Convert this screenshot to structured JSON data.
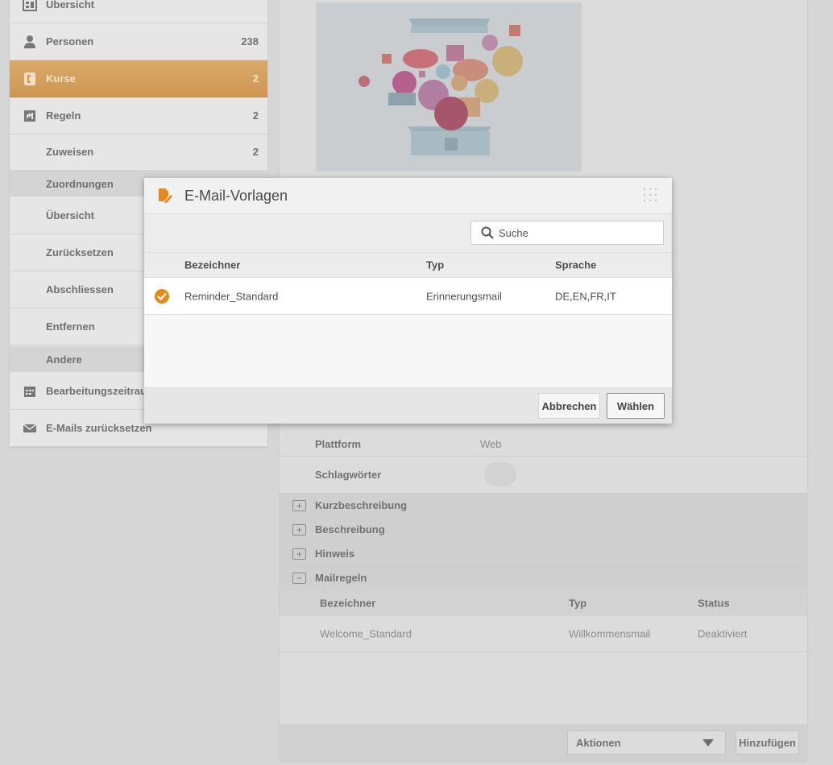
{
  "sidebar": {
    "items": [
      {
        "label": "Übersicht",
        "count": "",
        "icon": "dashboard-icon"
      },
      {
        "label": "Personen",
        "count": "238",
        "icon": "person-icon"
      },
      {
        "label": "Kurse",
        "count": "2",
        "icon": "course-icon"
      },
      {
        "label": "Regeln",
        "count": "2",
        "icon": "rule-icon"
      },
      {
        "label": "Zuweisen",
        "count": "2"
      }
    ],
    "section_zuordnungen": "Zuordnungen",
    "zuordnungen_items": [
      "Übersicht",
      "Zurücksetzen",
      "Abschliessen",
      "Entfernen"
    ],
    "section_andere": "Andere",
    "andere_items": [
      {
        "label": "Bearbeitungszeitraum",
        "icon": "calendar-icon"
      },
      {
        "label": "E-Mails zurücksetzen",
        "icon": "mail-icon"
      }
    ]
  },
  "main": {
    "fields": [
      {
        "key": "Plattform",
        "value": "Web"
      },
      {
        "key": "Schlagwörter",
        "value": ""
      }
    ],
    "sections": [
      {
        "label": "Kurzbeschreibung",
        "toggle": "+"
      },
      {
        "label": "Beschreibung",
        "toggle": "+"
      },
      {
        "label": "Hinweis",
        "toggle": "+"
      },
      {
        "label": "Mailregeln",
        "toggle": "−"
      }
    ],
    "mailrules": {
      "columns": [
        "Bezeichner",
        "Typ",
        "Status"
      ],
      "rows": [
        [
          "Welcome_Standard",
          "Willkommensmail",
          "Deaktiviert"
        ]
      ]
    },
    "actions_select": "Aktionen",
    "add_button": "Hinzufügen"
  },
  "modal": {
    "title": "E-Mail-Vorlagen",
    "search_placeholder": "Suche",
    "columns": [
      "Bezeichner",
      "Typ",
      "Sprache"
    ],
    "rows": [
      {
        "selected": true,
        "name": "Reminder_Standard",
        "type": "Erinnerungsmail",
        "language": "DE,EN,FR,IT"
      }
    ],
    "cancel_label": "Abbrechen",
    "choose_label": "Wählen"
  },
  "colors": {
    "accent": "#e88a1a",
    "active_sidebar": "#d39c59"
  }
}
